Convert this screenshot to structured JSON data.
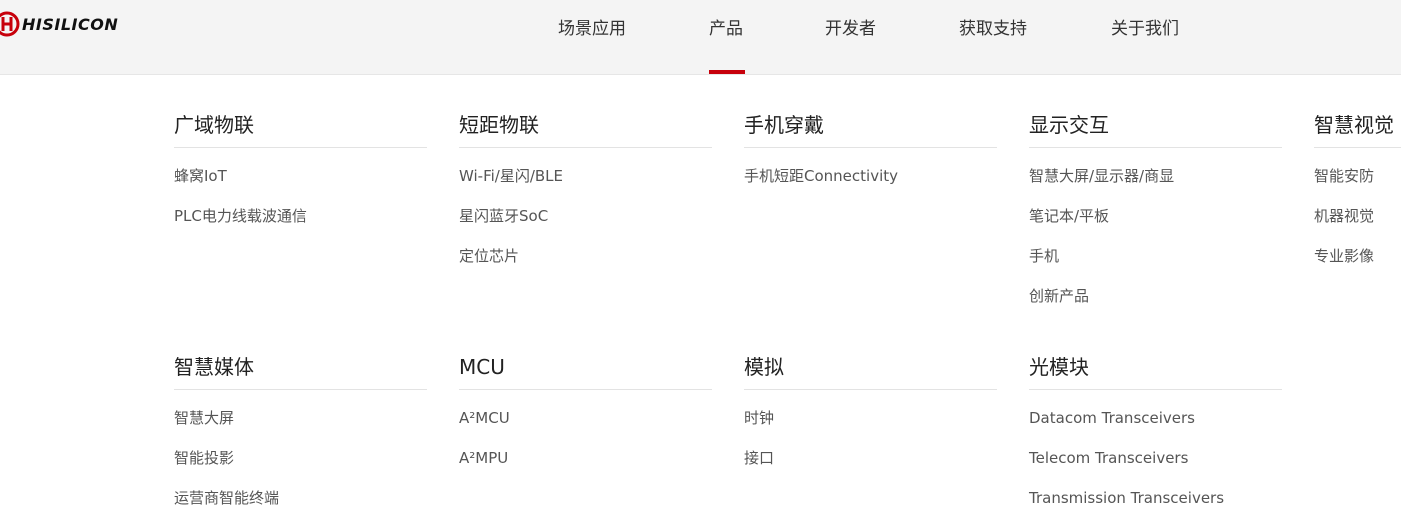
{
  "brand": {
    "logo_text": "HISILICON",
    "accent_color": "#c7000b"
  },
  "nav": {
    "items": [
      {
        "label": "场景应用"
      },
      {
        "label": "产品",
        "active": true
      },
      {
        "label": "开发者"
      },
      {
        "label": "获取支持"
      },
      {
        "label": "关于我们"
      }
    ]
  },
  "menu": {
    "rows": [
      {
        "columns": [
          {
            "title": "广域物联",
            "items": [
              "蜂窝IoT",
              "PLC电力线载波通信"
            ]
          },
          {
            "title": "短距物联",
            "items": [
              "Wi-Fi/星闪/BLE",
              "星闪蓝牙SoC",
              "定位芯片"
            ]
          },
          {
            "title": "手机穿戴",
            "items": [
              "手机短距Connectivity"
            ]
          },
          {
            "title": "显示交互",
            "items": [
              "智慧大屏/显示器/商显",
              "笔记本/平板",
              "手机",
              "创新产品"
            ]
          },
          {
            "title": "智慧视觉",
            "items": [
              "智能安防",
              "机器视觉",
              "专业影像"
            ]
          }
        ]
      },
      {
        "columns": [
          {
            "title": "智慧媒体",
            "items": [
              "智慧大屏",
              "智能投影",
              "运营商智能终端"
            ]
          },
          {
            "title": "MCU",
            "items": [
              "A²MCU",
              "A²MPU"
            ]
          },
          {
            "title": "模拟",
            "items": [
              "时钟",
              "接口"
            ]
          },
          {
            "title": "光模块",
            "items": [
              "Datacom Transceivers",
              "Telecom Transceivers",
              "Transmission Transceivers"
            ]
          }
        ]
      }
    ]
  }
}
